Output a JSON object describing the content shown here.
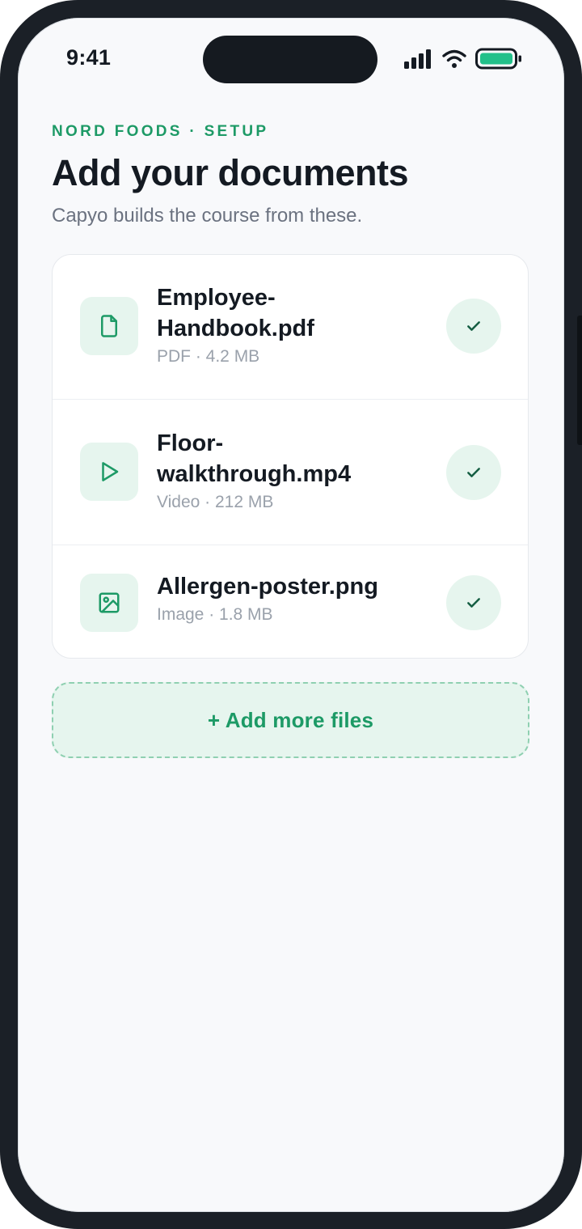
{
  "status_bar": {
    "time": "9:41"
  },
  "header": {
    "eyebrow": "NORD FOODS · SETUP",
    "title": "Add your documents",
    "subtitle": "Capyo builds the course from these."
  },
  "files": [
    {
      "name_line1": "Employee-",
      "name_line2": "Handbook.pdf",
      "meta": "PDF · 4.2 MB",
      "icon": "document-icon",
      "uploaded": true
    },
    {
      "name_line1": "Floor-",
      "name_line2": "walkthrough.mp4",
      "meta": "Video · 212 MB",
      "icon": "play-icon",
      "uploaded": true
    },
    {
      "name_line1": "Allergen-poster.png",
      "meta": "Image · 1.8 MB",
      "icon": "image-icon",
      "uploaded": true
    }
  ],
  "actions": {
    "add_more_label": "+ Add more files"
  },
  "colors": {
    "accent": "#1d9a66",
    "accent_soft": "#e6f5ee",
    "text_primary": "#141a22",
    "text_secondary": "#6b7280",
    "text_muted": "#9aa1ab",
    "battery_fill": "#22c08a"
  }
}
